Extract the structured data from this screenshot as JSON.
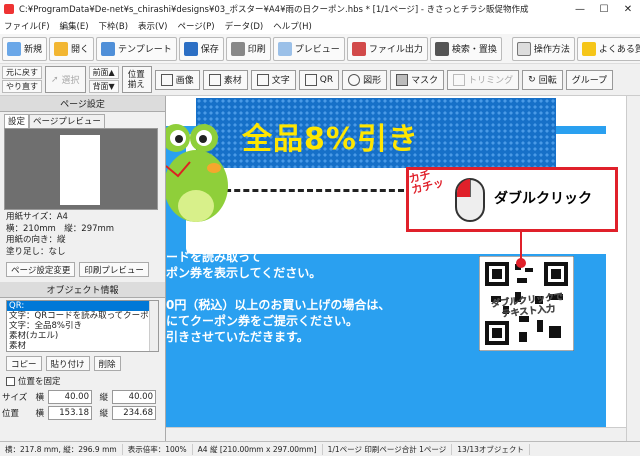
{
  "window": {
    "title": "C:¥ProgramData¥De-net¥s_chirashi¥designs¥03_ポスター¥A4¥雨の日クーポン.hbs * [1/1ページ] - きさっとチラシ販促物作成"
  },
  "menu": [
    "ファイル(F)",
    "編集(E)",
    "下枠(B)",
    "表示(V)",
    "ページ(P)",
    "データ(D)",
    "ヘルプ(H)"
  ],
  "toolbar": {
    "new": "新規",
    "open": "開く",
    "template": "テンプレート",
    "save": "保存",
    "print": "印刷",
    "preview": "プレビュー",
    "export": "ファイル出力",
    "search": "検索・置換",
    "howto": "操作方法",
    "faq": "よくある質問"
  },
  "toolbar2": {
    "undo": "元に戻す",
    "redo": "やり直す",
    "select": "選択",
    "front": "前面▲",
    "back": "背面▼",
    "align": "位置揃え",
    "image": "画像",
    "material": "素材",
    "text": "文字",
    "qr": "QR",
    "shape": "図形",
    "mask": "マスク",
    "trim": "トリミング",
    "rotate": "回転",
    "group": "グループ"
  },
  "page_settings": {
    "title": "ページ設定",
    "tabs": [
      "設定",
      "ページプレビュー"
    ],
    "paper_size": "用紙サイズ：A4",
    "dimensions": "横：210mm　縦：297mm",
    "orientation": "用紙の向き：縦",
    "bleed": "塗り足し：なし",
    "btn_change": "ページ設定変更",
    "btn_preview": "印刷プレビュー"
  },
  "object_info": {
    "title": "オブジェクト情報",
    "items": [
      "QR:",
      "文字：QRコードを読み取ってクーポ",
      "文字：全品8%引き",
      "素材(カエル)",
      "素材"
    ],
    "selected_index": 0,
    "btn_copy": "コピー",
    "btn_paste": "貼り付け",
    "btn_delete": "削除",
    "lock_label": "位置を固定",
    "size_label": "サイズ",
    "pos_label": "位置",
    "w_label": "横",
    "h_label": "縦",
    "size_w": "40.00",
    "size_h": "40.00",
    "pos_x": "153.18",
    "pos_y": "234.68"
  },
  "canvas": {
    "banner": "全品8%引き",
    "body_lines": [
      "ードを読み取って",
      "ポン券を表示してください。",
      "",
      "0円（税込）以上のお買い上げの場合は、",
      "にてクーポン券をご提示ください。",
      "引きさせていただきます。"
    ],
    "qr_caption": "ダブルクリックで\nテキスト入力",
    "callout_sfx": "カチ\nカチッ",
    "callout_text": "ダブルクリック"
  },
  "status": {
    "cursor": "横：217.8 mm, 縦：296.9 mm",
    "zoom": "表示倍率：100%",
    "paper": "A4 縦 [210.00mm x 297.00mm]",
    "pages": "1/1ページ 印刷ページ合計 1ページ",
    "objects": "13/13オブジェクト"
  },
  "colors": {
    "canvas_blue": "#2aa0f0",
    "banner_dots": "#1670c8",
    "banner_text": "#ffe600",
    "callout_red": "#e0202a"
  }
}
